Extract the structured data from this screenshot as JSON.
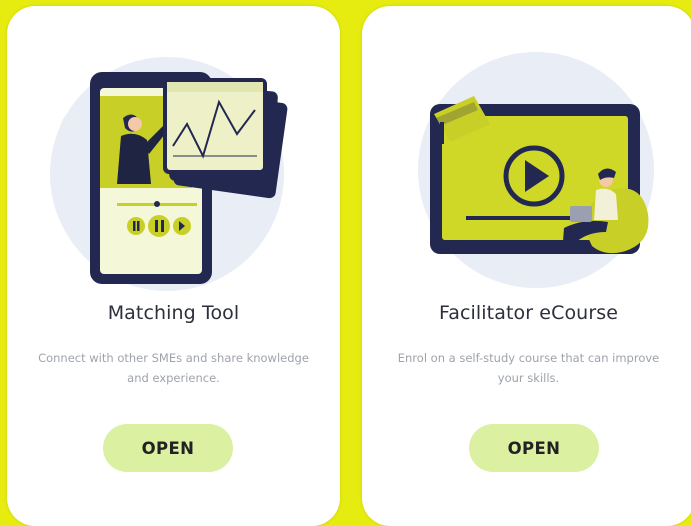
{
  "background_color": "#e6ec10",
  "accent_color": "#d4dc28",
  "button_color": "#dcf0a2",
  "cards": [
    {
      "title": "Matching Tool",
      "description": "Connect with other SMEs and share knowledge and experience.",
      "button_label": "OPEN",
      "illustration_icon": "phone-with-chart-illustration"
    },
    {
      "title": "Facilitator eCourse",
      "description": "Enrol on a self-study course that can improve your skills.",
      "button_label": "OPEN",
      "illustration_icon": "video-course-illustration"
    }
  ]
}
